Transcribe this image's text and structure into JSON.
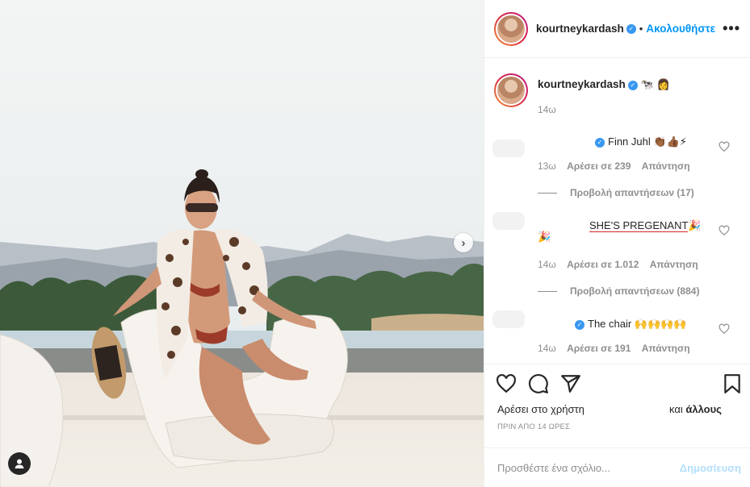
{
  "post": {
    "username": "kourtneykardash",
    "verified_icon": "verified-badge-icon",
    "follow_label": "Ακολουθήστε",
    "separator": "•",
    "more_label": "•••"
  },
  "caption": {
    "username": "kourtneykardash",
    "emojis": "🐄 👩",
    "time": "14ω"
  },
  "comments": [
    {
      "text": "Finn Juhl",
      "emojis": "👏🏾👍🏾⚡",
      "time": "13ω",
      "likes": "Αρέσει σε 239",
      "reply": "Απάντηση",
      "view_replies": "Προβολή απαντήσεων (17)"
    },
    {
      "text": "SHE'S PREGENANT",
      "emojis": "🎉",
      "emojis2": "🎉",
      "time": "14ω",
      "likes": "Αρέσει σε 1.012",
      "reply": "Απάντηση",
      "view_replies": "Προβολή απαντήσεων (884)"
    },
    {
      "text": "The chair",
      "emojis": "🙌🙌🙌🙌",
      "time": "14ω",
      "likes": "Αρέσει σε 191",
      "reply": "Απάντηση"
    }
  ],
  "actions": {
    "liked_by_label": "Αρέσει στο χρήστη",
    "and_others_prefix": "και",
    "and_others_bold": "άλλους",
    "posted_time": "ΠΡΙΝ ΑΠΟ 14 ΩΡΕΣ"
  },
  "add_comment": {
    "placeholder": "Προσθέστε ένα σχόλιο...",
    "post_label": "Δημοσίευση"
  },
  "photo": {
    "next_glyph": "›"
  },
  "colors": {
    "accent": "#0095f6",
    "verified": "#3897f0",
    "post_disabled": "#b2dffc",
    "underline": "#d62828"
  }
}
